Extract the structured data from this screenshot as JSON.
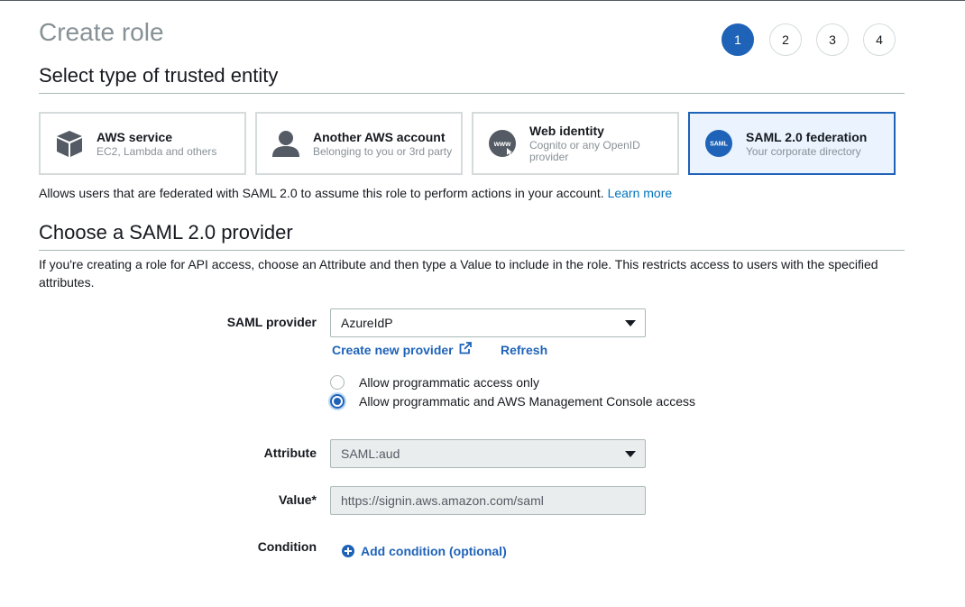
{
  "page": {
    "title": "Create role"
  },
  "steps": [
    "1",
    "2",
    "3",
    "4"
  ],
  "trusted_entity": {
    "heading": "Select type of trusted entity",
    "cards": [
      {
        "title": "AWS service",
        "subtitle": "EC2, Lambda and others",
        "icon": "cube-icon"
      },
      {
        "title": "Another AWS account",
        "subtitle": "Belonging to you or 3rd party",
        "icon": "person-icon"
      },
      {
        "title": "Web identity",
        "subtitle": "Cognito or any OpenID provider",
        "icon": "www-globe-icon"
      },
      {
        "title": "SAML 2.0 federation",
        "subtitle": "Your corporate directory",
        "icon": "saml-icon",
        "icon_text": "SAML"
      }
    ],
    "description": "Allows users that are federated with SAML 2.0 to assume this role to perform actions in your account.",
    "learn_more": "Learn more"
  },
  "saml": {
    "heading": "Choose a SAML 2.0 provider",
    "description": "If you're creating a role for API access, choose an Attribute and then type a Value to include in the role. This restricts access to users with the specified attributes.",
    "provider_label": "SAML provider",
    "provider_value": "AzureIdP",
    "create_provider": "Create new provider",
    "refresh": "Refresh",
    "access_options": [
      "Allow programmatic access only",
      "Allow programmatic and AWS Management Console access"
    ],
    "attribute_label": "Attribute",
    "attribute_value": "SAML:aud",
    "value_label": "Value*",
    "value_value": "https://signin.aws.amazon.com/saml",
    "condition_label": "Condition",
    "add_condition": "Add condition (optional)"
  },
  "colors": {
    "accent": "#1f63b8",
    "link": "#0073bb",
    "selected_bg": "#eaf3fe",
    "muted": "#879196"
  }
}
